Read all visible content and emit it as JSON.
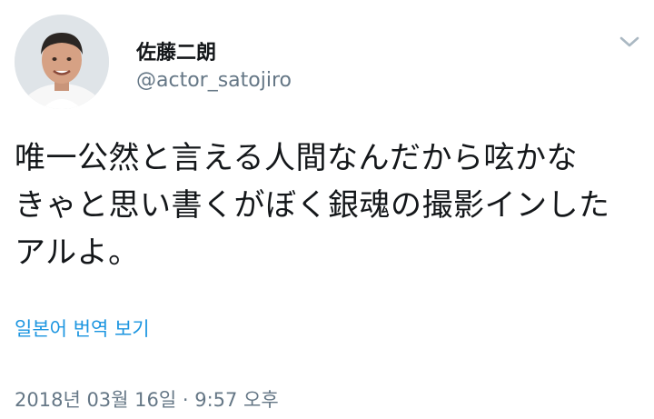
{
  "author": {
    "display_name": "佐藤二朗",
    "handle": "@actor_satojiro",
    "avatar_icon": "user-avatar-photo"
  },
  "tweet": {
    "text_lines": [
      "唯一公然と言える人間なんだから呟かな",
      "きゃと思い書くがぼく銀魂の撮影インした",
      "アルよ。"
    ],
    "translate_label": "일본어 번역 보기",
    "timestamp": "2018년 03월 16일 · 9:57 오후"
  },
  "menu": {
    "icon": "chevron-down-icon"
  },
  "colors": {
    "text_primary": "#14171a",
    "text_secondary": "#657786",
    "link": "#1b95e0",
    "chevron": "#aab8c2"
  }
}
